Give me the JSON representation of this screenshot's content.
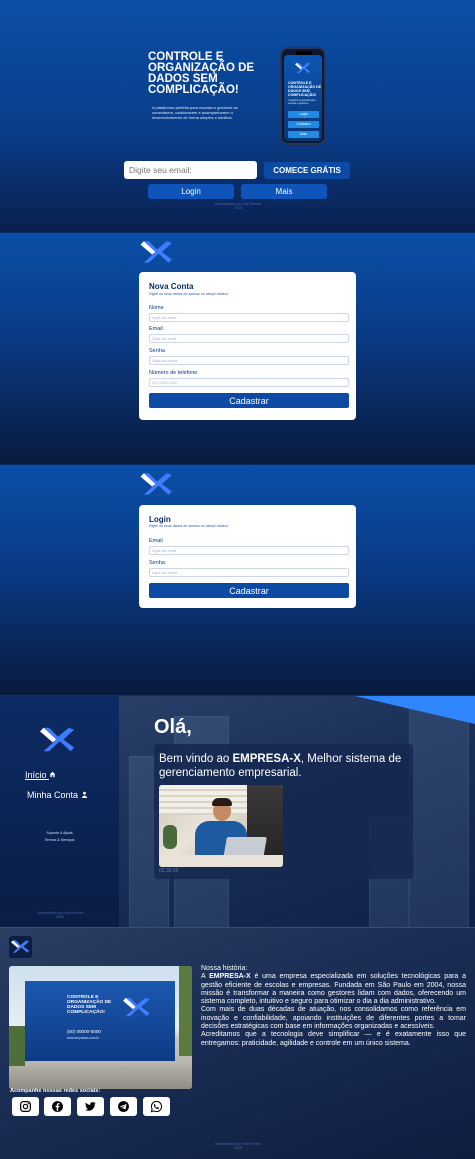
{
  "hero": {
    "title": "CONTROLE E ORGANIZAÇÃO DE DADOS SEM COMPLICAÇÃO!",
    "description": "A plataforma perfeita para escolas e gestores se conectarem, colaborarem e acompanharem o desenvolvimento de forma simples e intuitiva.",
    "phone_title": "CONTROLE E ORGANIZAÇÃO DE DADOS SEM COMPLICAÇÃO!",
    "phone_desc": "A plataforma perfeita para escolas e gestores...",
    "phone_buttons": [
      "Login",
      "Cadastro",
      "Mais"
    ],
    "email_placeholder": "Digite seu email:",
    "cta_label": "COMECE GRÁTIS",
    "login_label": "Login",
    "more_label": "Mais",
    "footer": "Desenvolvido por Levi Ferreira 2025"
  },
  "signup": {
    "title": "Nova Conta",
    "subtitle": "Digite os seus dados de acesso no campo abaixo",
    "name_label": "Nome",
    "name_placeholder": "Digite seu nome",
    "email_label": "Email",
    "email_placeholder": "Digite seu email",
    "password_label": "Senha",
    "password_placeholder": "Digite sua senha",
    "phone_label": "Número de telefone",
    "phone_placeholder": "(00) 00000-0000",
    "submit_label": "Cadastrar"
  },
  "login": {
    "title": "Login",
    "subtitle": "Digite os seus dados de acesso no campo abaixo",
    "email_label": "Email",
    "email_placeholder": "Digite seu email",
    "password_label": "Senha",
    "password_placeholder": "Digite sua senha",
    "submit_label": "Cadastrar"
  },
  "dashboard": {
    "nav_home": "Início",
    "nav_account": "Minha Conta",
    "support": "Suporte & Ajuda",
    "terms": "Termos & Serviços",
    "greeting": "Olá,",
    "welcome_pre": "Bem vindo ao ",
    "welcome_brand": "EMPRESA-X",
    "welcome_post": ", Melhor sistema de gerenciamento empresarial.",
    "time": "02:39:55",
    "footer": "Desenvolvido por Levi Ferreira 2025"
  },
  "about": {
    "wall_title": "CONTROLE E ORGANIZAÇÃO DE DADOS SEM COMPLICAÇÃO!",
    "wall_phone": "(00) 00000-0000",
    "wall_site": "www.empresax.com.br",
    "heading": "Nossa história:",
    "p1_pre": "A ",
    "p1_brand": "EMPRESA-X",
    "p1_post": " é uma empresa especializada em soluções tecnológicas para a gestão eficiente de escolas e empresas. Fundada em São Paulo em 2004, nossa missão é transformar a maneira como gestores lidam com dados, oferecendo um sistema completo, intuitivo e seguro para otimizar o dia a dia administrativo.",
    "p2": "Com mais de duas décadas de atuação, nos consolidamos como referência em inovação e confiabilidade, apoiando instituições de diferentes portes a tomar decisões estratégicas com base em informações organizadas e acessíveis.",
    "p3": "Acreditamos que a tecnologia deve simplificar — e é exatamente isso que entregamos: praticidade, agilidade e controle em um único sistema.",
    "social_heading": "Acompanhe nossas redes sociais:",
    "social": [
      "instagram-icon",
      "facebook-icon",
      "twitter-icon",
      "telegram-icon",
      "whatsapp-icon"
    ],
    "footer": "Desenvolvido por Levi Ferreira 2025"
  },
  "colors": {
    "primary": "#0d4aa3",
    "accent": "#2e7bff",
    "dark": "#0a1a3a"
  }
}
